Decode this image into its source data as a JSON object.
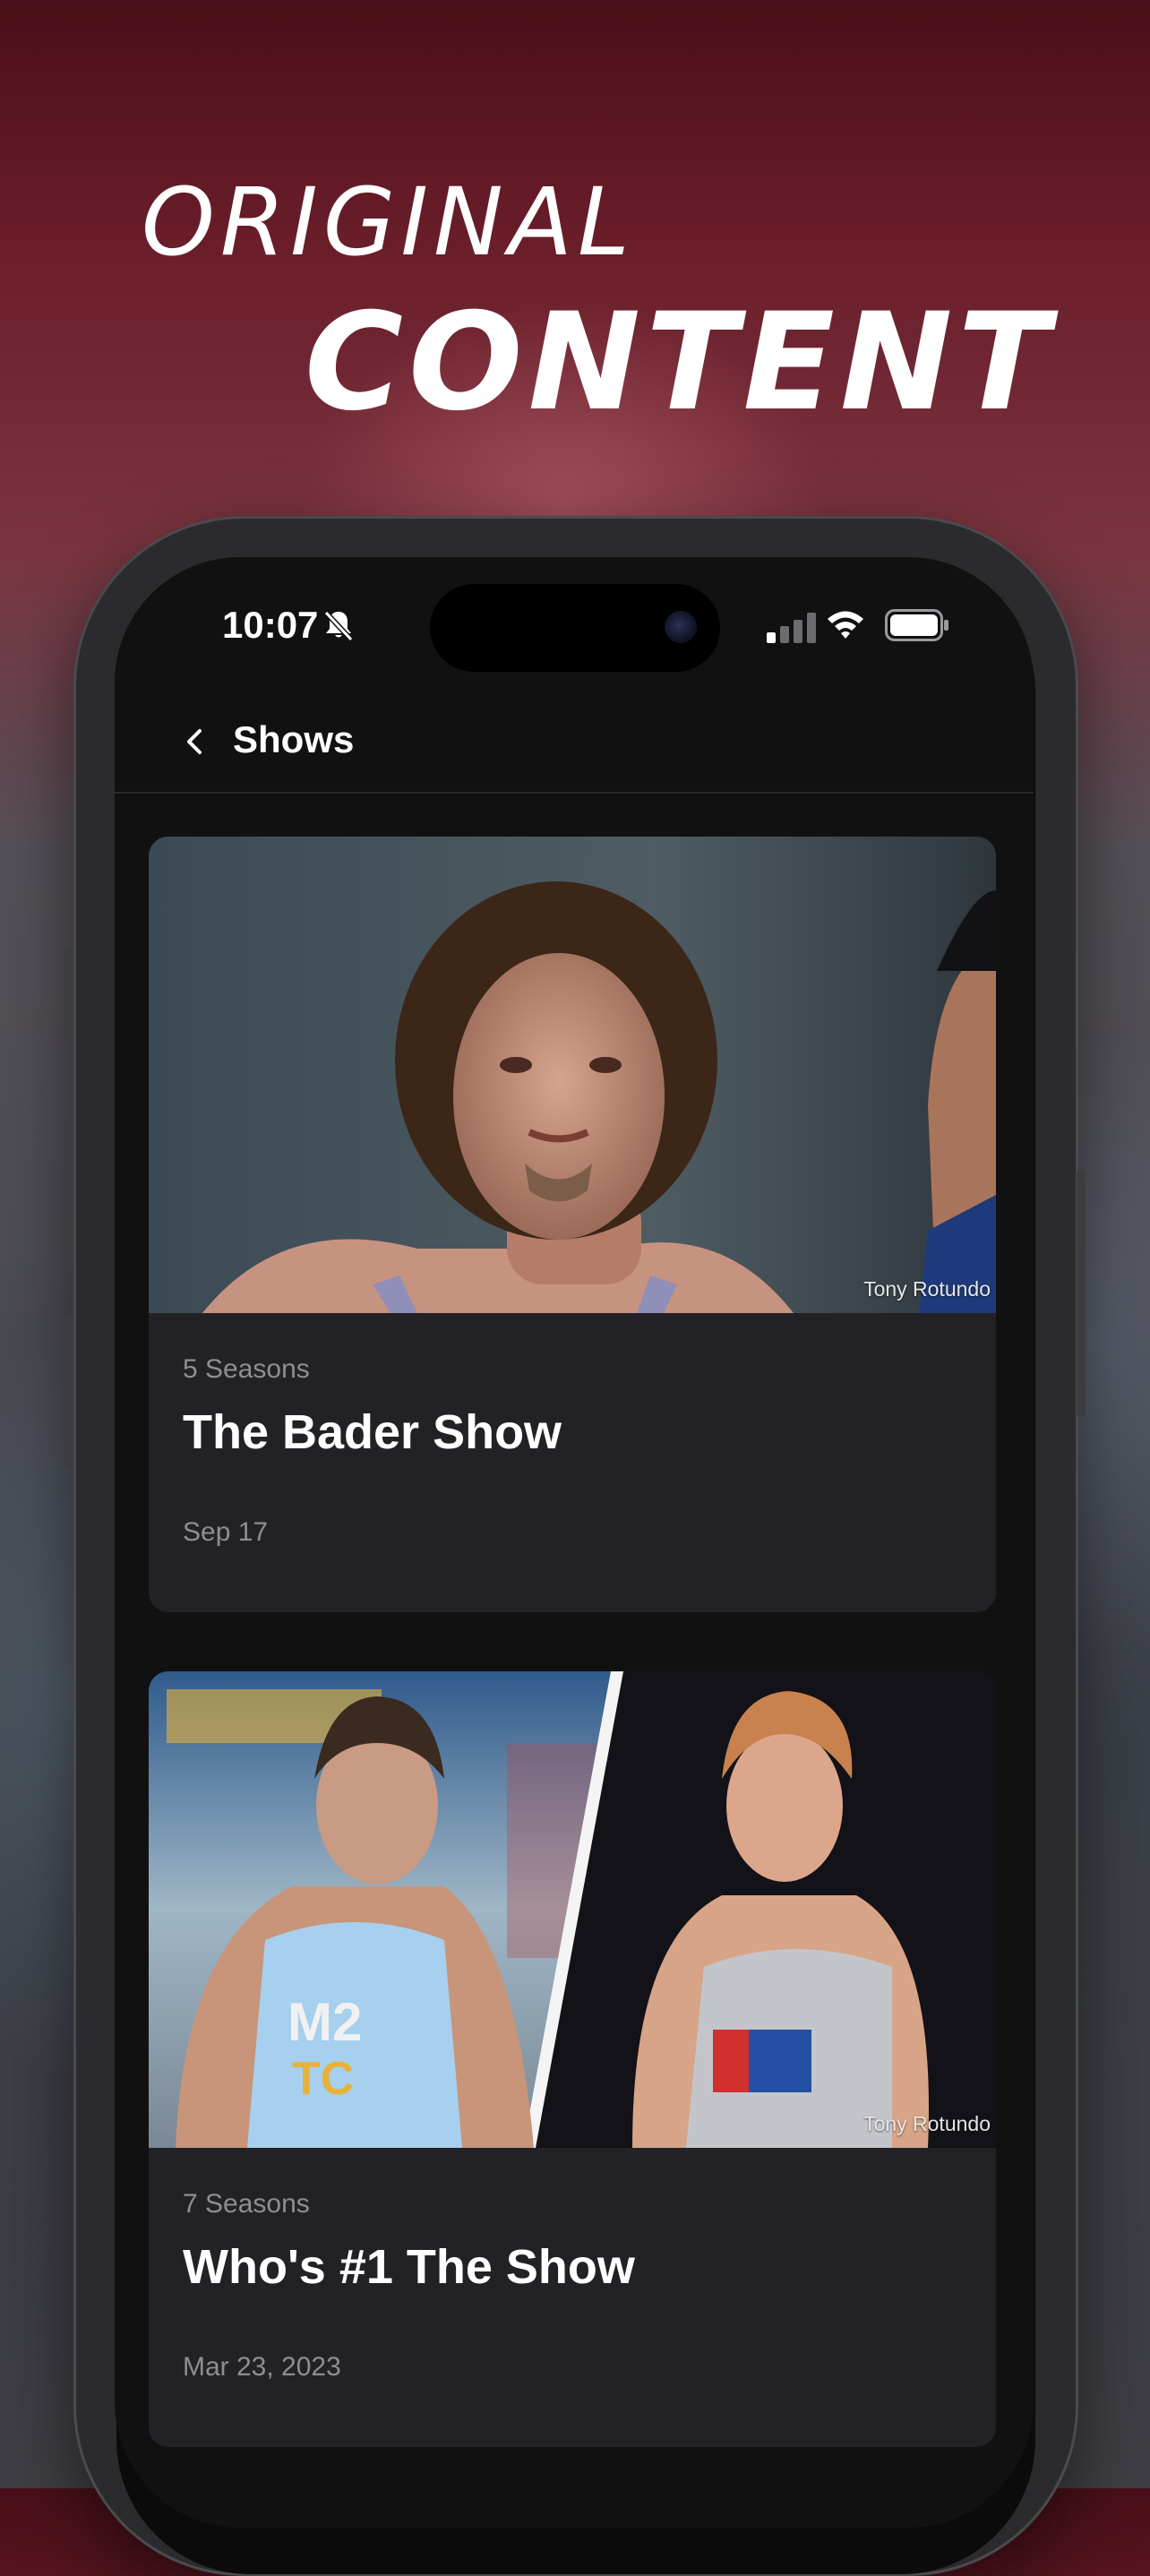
{
  "promo": {
    "line1": "ORIGINAL",
    "line2": "CONTENT"
  },
  "status_bar": {
    "time": "10:07",
    "icons": [
      "bell-slash-icon",
      "cellular-signal-icon",
      "wifi-icon",
      "battery-icon"
    ]
  },
  "nav": {
    "back_icon": "chevron-left-icon",
    "title": "Shows"
  },
  "shows": [
    {
      "seasons": "5 Seasons",
      "title": "The Bader Show",
      "date": "Sep 17",
      "photo_credit": "Tony Rotundo"
    },
    {
      "seasons": "7 Seasons",
      "title": "Who's #1 The Show",
      "date": "Mar 23, 2023",
      "photo_credit": "Tony Rotundo"
    }
  ],
  "colors": {
    "screen_bg": "#111112",
    "card_bg": "#222226",
    "secondary_text": "#8d8d93",
    "primary_text": "#ffffff"
  }
}
